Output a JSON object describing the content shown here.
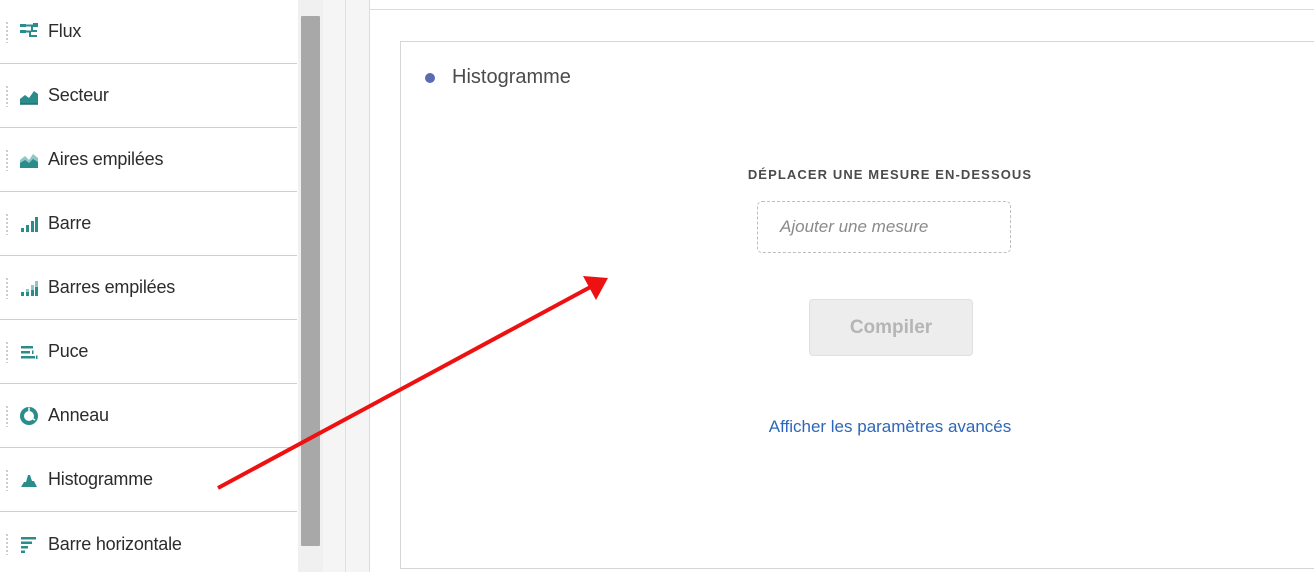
{
  "sidebar": {
    "items": [
      {
        "label": "Flux",
        "icon": "flow-icon"
      },
      {
        "label": "Secteur",
        "icon": "area-chart-icon"
      },
      {
        "label": "Aires empilées",
        "icon": "stacked-area-icon"
      },
      {
        "label": "Barre",
        "icon": "bar-chart-icon"
      },
      {
        "label": "Barres empilées",
        "icon": "stacked-bar-icon"
      },
      {
        "label": "Puce",
        "icon": "bullet-chart-icon"
      },
      {
        "label": "Anneau",
        "icon": "donut-icon"
      },
      {
        "label": "Histogramme",
        "icon": "histogram-icon"
      },
      {
        "label": "Barre horizontale",
        "icon": "horizontal-bar-icon"
      }
    ]
  },
  "panel": {
    "title": "Histogramme",
    "drop_label": "DÉPLACER UNE MESURE EN-DESSOUS",
    "add_metric_placeholder": "Ajouter une mesure",
    "compile_label": "Compiler",
    "advanced_link": "Afficher les paramètres avancés"
  },
  "colors": {
    "icon_teal": "#2b8c8c",
    "title_dot": "#5c6bb0",
    "link_blue": "#2d67b9",
    "annotation_arrow": "#ee1111"
  }
}
